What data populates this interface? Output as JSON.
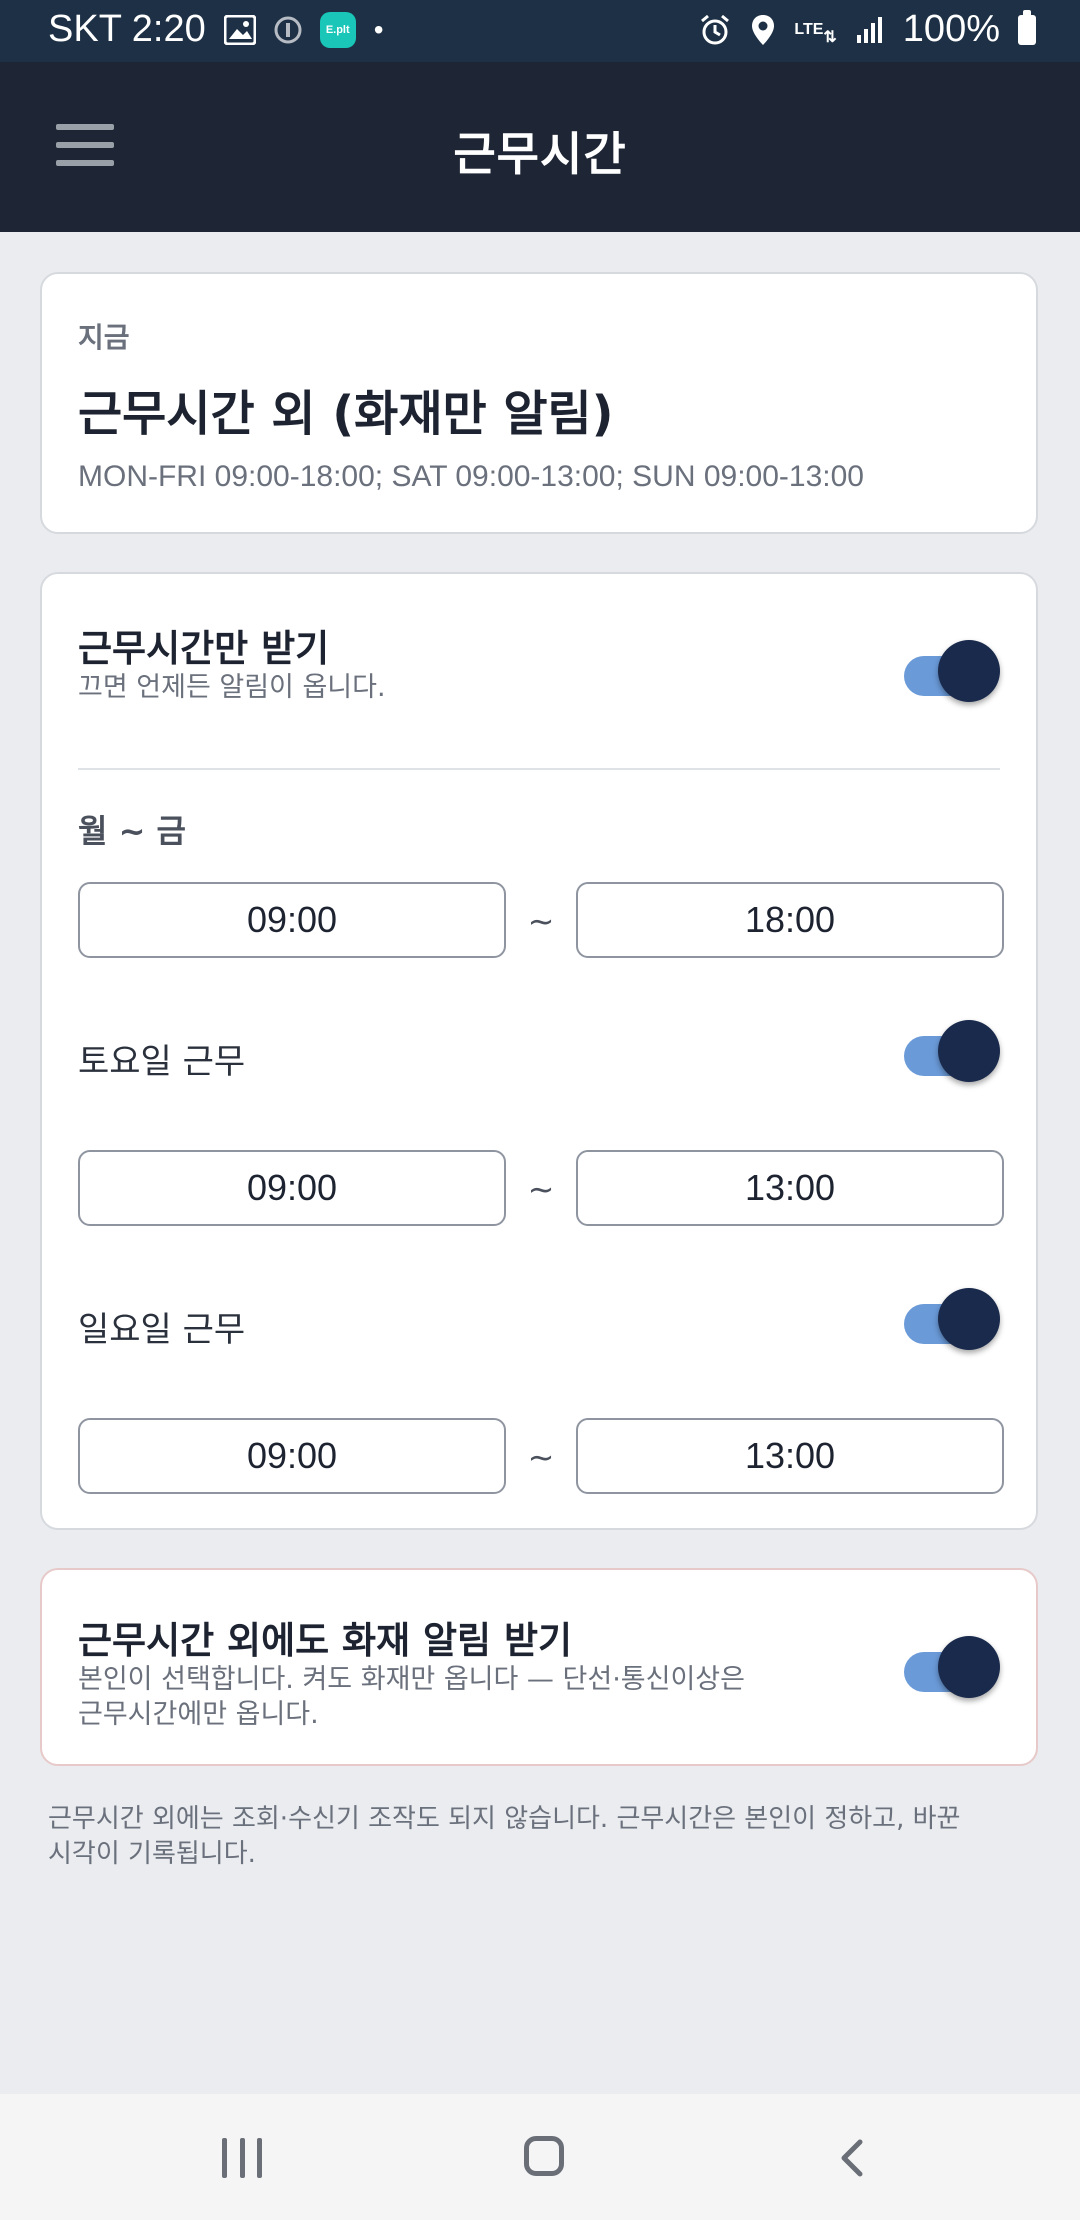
{
  "status_bar": {
    "carrier_time": "SKT 2:20",
    "app_badge": "E.plt",
    "dot": "•",
    "network": "LTE",
    "battery": "100%",
    "icons": [
      "image-icon",
      "info-icon",
      "eplit-app-icon",
      "alarm-icon",
      "location-icon",
      "lte-icon",
      "signal-icon",
      "battery-icon"
    ]
  },
  "app_bar": {
    "title": "근무시간",
    "menu_icon": "hamburger-menu-icon"
  },
  "now_card": {
    "label": "지금",
    "status": "근무시간 외 (화재만 알림)",
    "schedule": "MON-FRI 09:00-18:00; SAT 09:00-13:00; SUN 09:00-13:00"
  },
  "settings_card": {
    "work_hours_only": {
      "title": "근무시간만 받기",
      "description": "끄면 언제든 알림이 옵니다.",
      "enabled": true
    },
    "weekday": {
      "label": "월 ~ 금",
      "start": "09:00",
      "end": "18:00",
      "separator": "~"
    },
    "saturday": {
      "label": "토요일 근무",
      "enabled": true,
      "start": "09:00",
      "end": "13:00",
      "separator": "~"
    },
    "sunday": {
      "label": "일요일 근무",
      "enabled": true,
      "start": "09:00",
      "end": "13:00",
      "separator": "~"
    }
  },
  "fire_card": {
    "title": "근무시간 외에도 화재 알림 받기",
    "description_line1": "본인이 선택합니다. 켜도 화재만 옵니다 — 단선·통신이상은",
    "description_line2": "근무시간에만 옵니다.",
    "enabled": true
  },
  "footer": {
    "note_line1": "근무시간 외에는 조회·수신기 조작도 되지 않습니다. 근무시간은 본인이 정하고, 바꾼",
    "note_line2": "시각이 기록됩니다."
  },
  "colors": {
    "status_bar_bg": "#1d3045",
    "app_bar_bg": "#1e2534",
    "page_bg": "#eaecef",
    "toggle_track": "#6a9ad8",
    "toggle_knob": "#1a2a4c",
    "fire_card_border": "#e8c9c9"
  }
}
